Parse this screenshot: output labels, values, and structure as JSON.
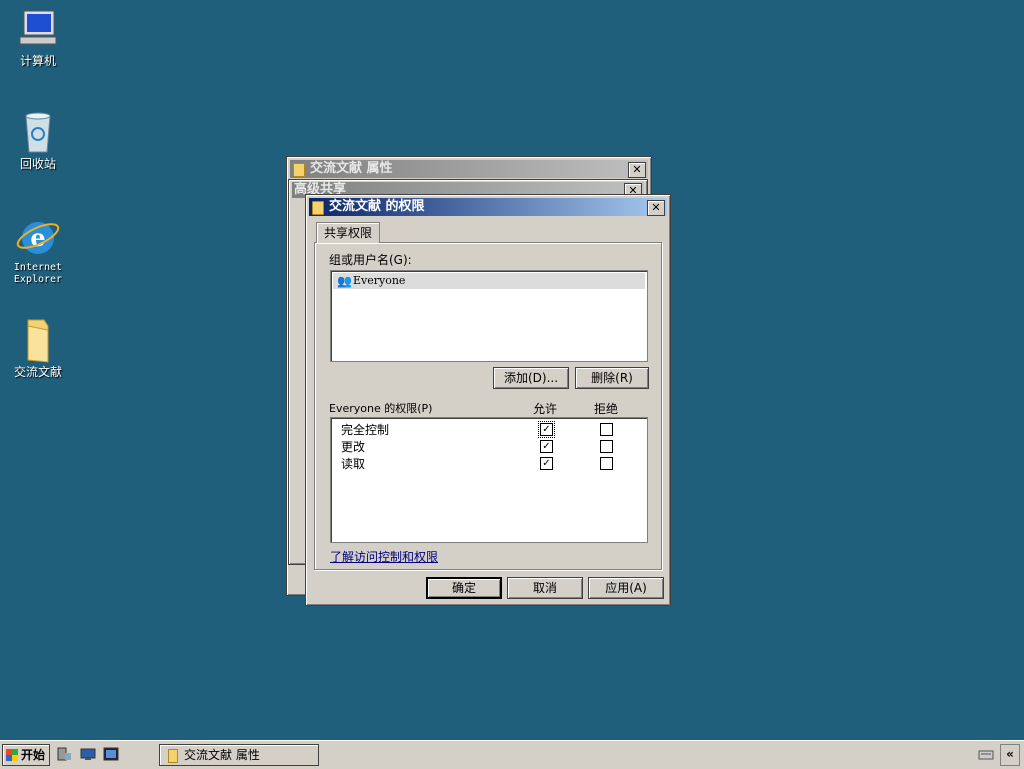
{
  "desktop": {
    "icons": [
      {
        "label": "计算机"
      },
      {
        "label": "回收站"
      },
      {
        "label": "Internet Explorer"
      },
      {
        "label": "交流文献"
      }
    ]
  },
  "prop_window": {
    "title": "交流文献 属性"
  },
  "adv_window": {
    "title": "高级共享"
  },
  "perm_dialog": {
    "title": "交流文献 的权限",
    "tab": "共享权限",
    "group_label": "组或用户名(G):",
    "users": [
      "Everyone"
    ],
    "add_button": "添加(D)...",
    "remove_button": "删除(R)",
    "perm_label": "Everyone 的权限(P)",
    "col_allow": "允许",
    "col_deny": "拒绝",
    "permissions": [
      {
        "name": "完全控制",
        "allow": true,
        "deny": false
      },
      {
        "name": "更改",
        "allow": true,
        "deny": false
      },
      {
        "name": "读取",
        "allow": true,
        "deny": false
      }
    ],
    "help_link": "了解访问控制和权限",
    "ok_button": "确定",
    "cancel_button": "取消",
    "apply_button": "应用(A)"
  },
  "taskbar": {
    "start_label": "开始",
    "task_item": "交流文献 属性",
    "collapse": "«"
  },
  "colors": {
    "desktop": "#1f5f7c",
    "active_title": "#0a246a",
    "window": "#d4d0c8"
  }
}
